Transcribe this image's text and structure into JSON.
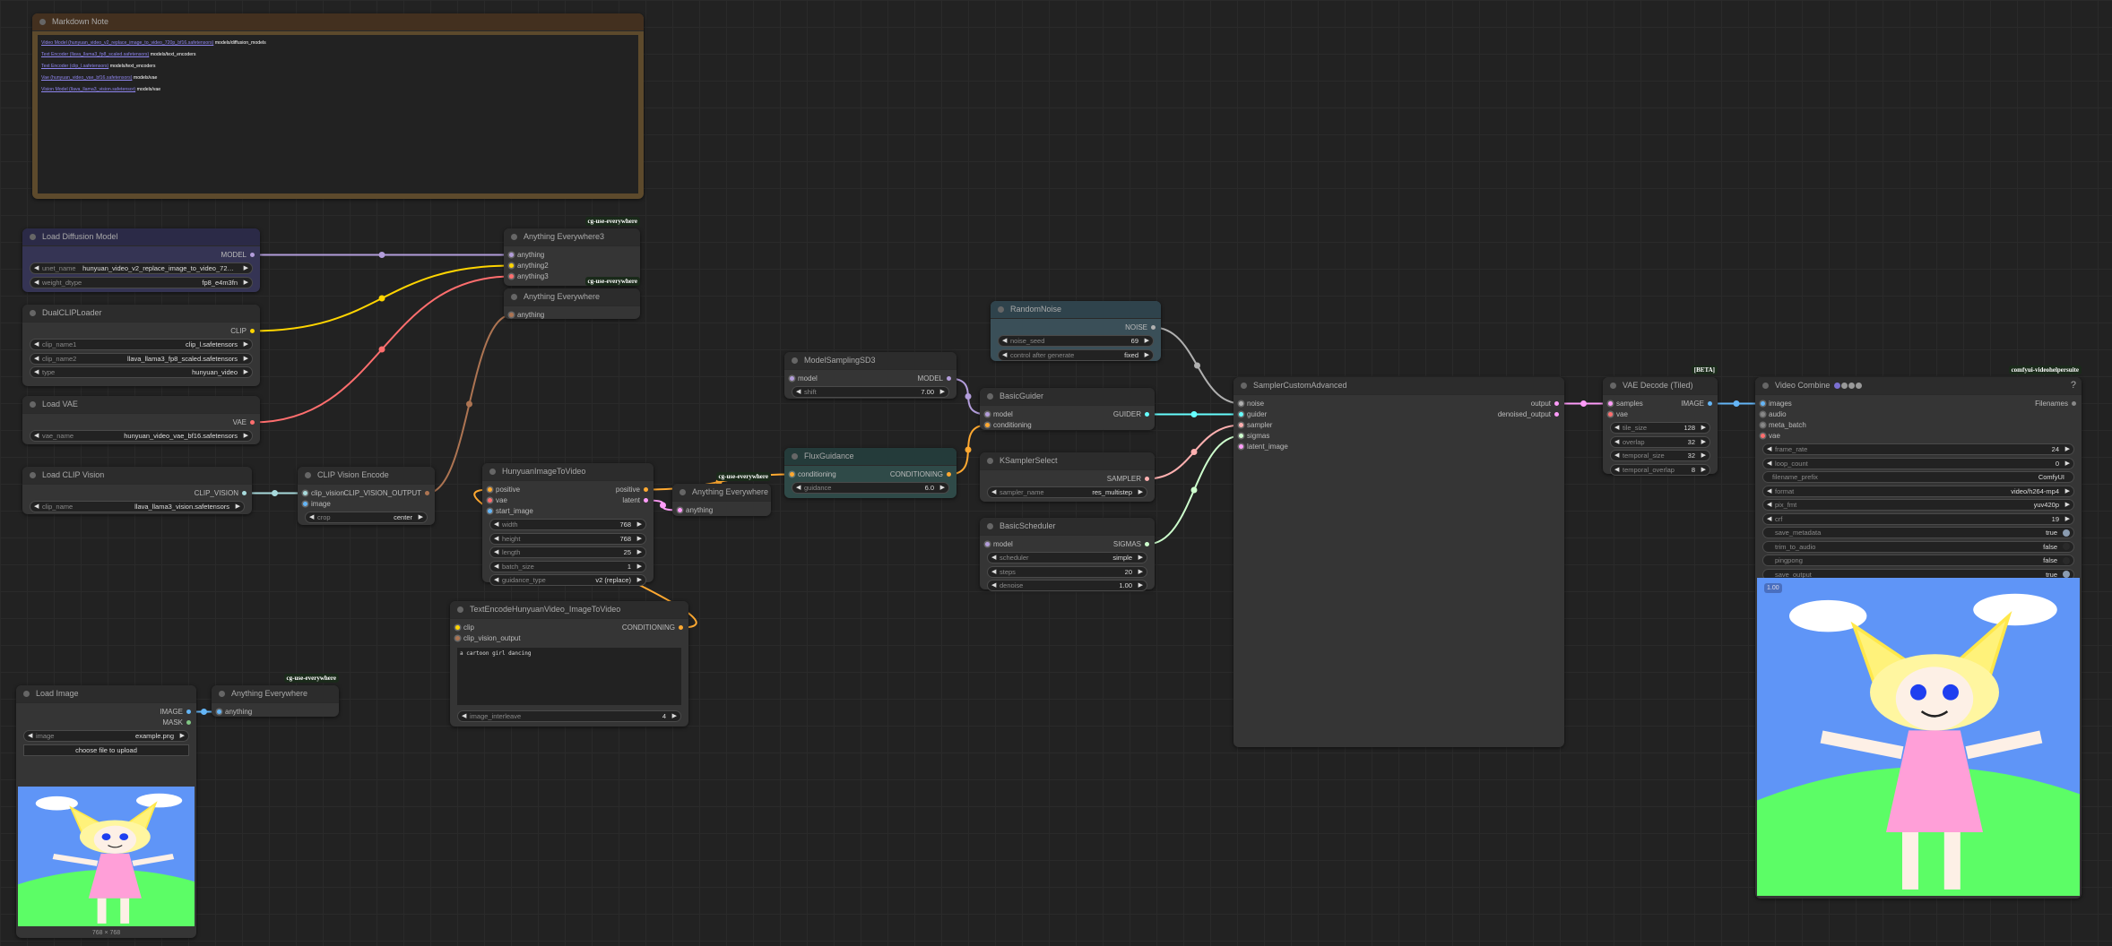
{
  "markdown_note": {
    "title": "Markdown Note",
    "rows": [
      {
        "link": "Video Model (hunyuan_video_v2_replace_image_to_video_720p_bf16.safetensors)",
        "path": "models/diffusion_models"
      },
      {
        "link": "Text Encoder (llava_llama3_fp8_scaled.safetensors)",
        "path": "models/text_encoders"
      },
      {
        "link": "Text Encoder (clip_l.safetensors)",
        "path": "models/text_encoders"
      },
      {
        "link": "Vae (hunyuan_video_vae_bf16.safetensors)",
        "path": "models/vae"
      },
      {
        "link": "Vision Model (llava_llama3_vision.safetensor)",
        "path": "models/vae"
      }
    ]
  },
  "colors": {
    "MODEL": "#b39ddb",
    "CLIP": "#ffd500",
    "VAE": "#ff6e6e",
    "CLIP_VISION": "#a8dadc",
    "CLIP_VISION_OUTPUT": "#ad7452",
    "CONDITIONING": "#ffa931",
    "LATENT": "#ff9cf9",
    "IMAGE": "#64b5f6",
    "MASK": "#81c784",
    "NOISE": "#b0b0b0",
    "GUIDER": "#66ffff",
    "SAMPLER": "#ffb0b0",
    "SIGMAS": "#cdffcd",
    "ANY": "#888888"
  },
  "nodes": [
    {
      "id": "ldm",
      "title": "Load Diffusion Model",
      "bg": "#353454",
      "hd": "#2b2a47",
      "outputs": [
        {
          "label": "MODEL",
          "type": "MODEL"
        }
      ],
      "widgets": [
        {
          "k": "combo",
          "name": "unet_name",
          "value": "hunyuan_video_v2_replace_image_to_video_720p..."
        },
        {
          "k": "combo",
          "name": "weight_dtype",
          "value": "fp8_e4m3fn"
        }
      ]
    },
    {
      "id": "dcl",
      "title": "DualCLIPLoader",
      "outputs": [
        {
          "label": "CLIP",
          "type": "CLIP"
        }
      ],
      "widgets": [
        {
          "k": "combo",
          "name": "clip_name1",
          "value": "clip_l.safetensors"
        },
        {
          "k": "combo",
          "name": "clip_name2",
          "value": "llava_llama3_fp8_scaled.safetensors"
        },
        {
          "k": "combo",
          "name": "type",
          "value": "hunyuan_video"
        }
      ]
    },
    {
      "id": "vae",
      "title": "Load VAE",
      "outputs": [
        {
          "label": "VAE",
          "type": "VAE"
        }
      ],
      "widgets": [
        {
          "k": "combo",
          "name": "vae_name",
          "value": "hunyuan_video_vae_bf16.safetensors"
        }
      ]
    },
    {
      "id": "lcv",
      "title": "Load CLIP Vision",
      "outputs": [
        {
          "label": "CLIP_VISION",
          "type": "CLIP_VISION"
        }
      ],
      "widgets": [
        {
          "k": "combo",
          "name": "clip_name",
          "value": "llava_llama3_vision.safetensors"
        }
      ]
    },
    {
      "id": "cve",
      "title": "CLIP Vision Encode",
      "inputs": [
        {
          "label": "clip_vision",
          "type": "CLIP_VISION"
        },
        {
          "label": "image",
          "type": "IMAGE"
        }
      ],
      "outputs": [
        {
          "label": "CLIP_VISION_OUTPUT",
          "type": "CLIP_VISION_OUTPUT"
        }
      ],
      "widgets": [
        {
          "k": "combo",
          "name": "crop",
          "value": "center"
        }
      ]
    },
    {
      "id": "ae3",
      "title": "Anything Everywhere3",
      "badge": "cg-use-everywhere",
      "inputs": [
        {
          "label": "anything",
          "type": "MODEL"
        },
        {
          "label": "anything2",
          "type": "CLIP"
        },
        {
          "label": "anything3",
          "type": "VAE"
        }
      ]
    },
    {
      "id": "ae1",
      "title": "Anything Everywhere",
      "badge": "cg-use-everywhere",
      "inputs": [
        {
          "label": "anything",
          "type": "CLIP_VISION_OUTPUT"
        }
      ]
    },
    {
      "id": "h2v",
      "title": "HunyuanImageToVideo",
      "inputs": [
        {
          "label": "positive",
          "type": "CONDITIONING"
        },
        {
          "label": "vae",
          "type": "VAE"
        },
        {
          "label": "start_image",
          "type": "IMAGE"
        }
      ],
      "outputs": [
        {
          "label": "positive",
          "type": "CONDITIONING"
        },
        {
          "label": "latent",
          "type": "LATENT"
        }
      ],
      "widgets": [
        {
          "k": "num",
          "name": "width",
          "value": "768"
        },
        {
          "k": "num",
          "name": "height",
          "value": "768"
        },
        {
          "k": "num",
          "name": "length",
          "value": "25"
        },
        {
          "k": "num",
          "name": "batch_size",
          "value": "1"
        },
        {
          "k": "combo",
          "name": "guidance_type",
          "value": "v2 (replace)"
        }
      ]
    },
    {
      "id": "ae2",
      "title": "Anything Everywhere",
      "badge": "cg-use-everywhere",
      "inputs": [
        {
          "label": "anything",
          "type": "LATENT"
        }
      ]
    },
    {
      "id": "te",
      "title": "TextEncodeHunyuanVideo_ImageToVideo",
      "inputs": [
        {
          "label": "clip",
          "type": "CLIP"
        },
        {
          "label": "clip_vision_output",
          "type": "CLIP_VISION_OUTPUT"
        }
      ],
      "outputs": [
        {
          "label": "CONDITIONING",
          "type": "CONDITIONING"
        }
      ],
      "textarea": "a cartoon girl dancing",
      "widgets": [
        {
          "k": "num",
          "name": "image_interleave",
          "value": "4"
        }
      ]
    },
    {
      "id": "ms",
      "title": "ModelSamplingSD3",
      "inputs": [
        {
          "label": "model",
          "type": "MODEL"
        }
      ],
      "outputs": [
        {
          "label": "MODEL",
          "type": "MODEL"
        }
      ],
      "widgets": [
        {
          "k": "num",
          "name": "shift",
          "value": "7.00"
        }
      ]
    },
    {
      "id": "fg",
      "title": "FluxGuidance",
      "bg": "#2f4a48",
      "hd": "#243b3a",
      "inputs": [
        {
          "label": "conditioning",
          "type": "CONDITIONING"
        }
      ],
      "outputs": [
        {
          "label": "CONDITIONING",
          "type": "CONDITIONING"
        }
      ],
      "widgets": [
        {
          "k": "num",
          "name": "guidance",
          "value": "6.0"
        }
      ]
    },
    {
      "id": "rn",
      "title": "RandomNoise",
      "bg": "#3a4f58",
      "hd": "#2f434c",
      "outputs": [
        {
          "label": "NOISE",
          "type": "NOISE"
        }
      ],
      "widgets": [
        {
          "k": "num",
          "name": "noise_seed",
          "value": "69"
        },
        {
          "k": "combo",
          "name": "control after generate",
          "value": "fixed"
        }
      ]
    },
    {
      "id": "bg",
      "title": "BasicGuider",
      "inputs": [
        {
          "label": "model",
          "type": "MODEL"
        },
        {
          "label": "conditioning",
          "type": "CONDITIONING"
        }
      ],
      "outputs": [
        {
          "label": "GUIDER",
          "type": "GUIDER"
        }
      ]
    },
    {
      "id": "ks",
      "title": "KSamplerSelect",
      "outputs": [
        {
          "label": "SAMPLER",
          "type": "SAMPLER"
        }
      ],
      "widgets": [
        {
          "k": "combo",
          "name": "sampler_name",
          "value": "res_multistep"
        }
      ]
    },
    {
      "id": "bs",
      "title": "BasicScheduler",
      "inputs": [
        {
          "label": "model",
          "type": "MODEL"
        }
      ],
      "outputs": [
        {
          "label": "SIGMAS",
          "type": "SIGMAS"
        }
      ],
      "widgets": [
        {
          "k": "combo",
          "name": "scheduler",
          "value": "simple"
        },
        {
          "k": "num",
          "name": "steps",
          "value": "20"
        },
        {
          "k": "num",
          "name": "denoise",
          "value": "1.00"
        }
      ]
    },
    {
      "id": "sca",
      "title": "SamplerCustomAdvanced",
      "inputs": [
        {
          "label": "noise",
          "type": "NOISE"
        },
        {
          "label": "guider",
          "type": "GUIDER"
        },
        {
          "label": "sampler",
          "type": "SAMPLER"
        },
        {
          "label": "sigmas",
          "type": "SIGMAS"
        },
        {
          "label": "latent_image",
          "type": "LATENT"
        }
      ],
      "outputs": [
        {
          "label": "output",
          "type": "LATENT"
        },
        {
          "label": "denoised_output",
          "type": "LATENT"
        }
      ]
    },
    {
      "id": "vd",
      "title": "VAE Decode (Tiled)",
      "badge": "[BETA]",
      "inputs": [
        {
          "label": "samples",
          "type": "LATENT"
        },
        {
          "label": "vae",
          "type": "VAE"
        }
      ],
      "outputs": [
        {
          "label": "IMAGE",
          "type": "IMAGE"
        }
      ],
      "widgets": [
        {
          "k": "num",
          "name": "tile_size",
          "value": "128"
        },
        {
          "k": "num",
          "name": "overlap",
          "value": "32"
        },
        {
          "k": "num",
          "name": "temporal_size",
          "value": "32"
        },
        {
          "k": "num",
          "name": "temporal_overlap",
          "value": "8"
        }
      ]
    },
    {
      "id": "vc",
      "title": "Video Combine",
      "badge": "comfyui-videohelpersuite",
      "help": "?",
      "inputs": [
        {
          "label": "images",
          "type": "IMAGE"
        },
        {
          "label": "audio",
          "type": "ANY"
        },
        {
          "label": "meta_batch",
          "type": "ANY"
        },
        {
          "label": "vae",
          "type": "VAE"
        }
      ],
      "outputs": [
        {
          "label": "Filenames",
          "type": "ANY"
        }
      ],
      "widgets": [
        {
          "k": "num",
          "name": "frame_rate",
          "value": "24"
        },
        {
          "k": "num",
          "name": "loop_count",
          "value": "0"
        },
        {
          "k": "text",
          "name": "filename_prefix",
          "value": "ComfyUI"
        },
        {
          "k": "combo",
          "name": "format",
          "value": "video/h264-mp4"
        },
        {
          "k": "combo",
          "name": "pix_fmt",
          "value": "yuv420p"
        },
        {
          "k": "num",
          "name": "crf",
          "value": "19"
        },
        {
          "k": "toggle",
          "name": "save_metadata",
          "value": "true"
        },
        {
          "k": "toggle",
          "name": "trim_to_audio",
          "value": "false"
        },
        {
          "k": "toggle",
          "name": "pingpong",
          "value": "false"
        },
        {
          "k": "toggle",
          "name": "save_output",
          "value": "true"
        }
      ],
      "preview_tag": "1.00"
    },
    {
      "id": "li",
      "title": "Load Image",
      "outputs": [
        {
          "label": "IMAGE",
          "type": "IMAGE"
        },
        {
          "label": "MASK",
          "type": "MASK"
        }
      ],
      "widgets": [
        {
          "k": "combo",
          "name": "image",
          "value": "example.png"
        },
        {
          "k": "button",
          "name": "choose file to upload"
        }
      ],
      "footer": "768 × 768"
    },
    {
      "id": "ae4",
      "title": "Anything Everywhere",
      "badge": "cg-use-everywhere",
      "inputs": [
        {
          "label": "anything",
          "type": "IMAGE"
        }
      ]
    }
  ],
  "links": [
    [
      "ldm",
      0,
      "ae3",
      0,
      "MODEL"
    ],
    [
      "dcl",
      0,
      "ae3",
      1,
      "CLIP"
    ],
    [
      "vae",
      0,
      "ae3",
      2,
      "VAE"
    ],
    [
      "cve",
      0,
      "ae1",
      0,
      "CLIP_VISION_OUTPUT"
    ],
    [
      "lcv",
      0,
      "cve",
      0,
      "CLIP_VISION"
    ],
    [
      "h2v",
      0,
      "fg",
      0,
      "CONDITIONING"
    ],
    [
      "h2v",
      1,
      "ae2",
      0,
      "LATENT"
    ],
    [
      "te",
      0,
      "h2v",
      0,
      "CONDITIONING"
    ],
    [
      "ms",
      0,
      "bg",
      0,
      "MODEL"
    ],
    [
      "fg",
      0,
      "bg",
      1,
      "CONDITIONING"
    ],
    [
      "rn",
      0,
      "sca",
      0,
      "NOISE"
    ],
    [
      "bg",
      0,
      "sca",
      1,
      "GUIDER"
    ],
    [
      "ks",
      0,
      "sca",
      2,
      "SAMPLER"
    ],
    [
      "bs",
      0,
      "sca",
      3,
      "SIGMAS"
    ],
    [
      "sca",
      0,
      "vd",
      0,
      "LATENT"
    ],
    [
      "vd",
      0,
      "vc",
      0,
      "IMAGE"
    ],
    [
      "li",
      0,
      "ae4",
      0,
      "IMAGE"
    ]
  ]
}
